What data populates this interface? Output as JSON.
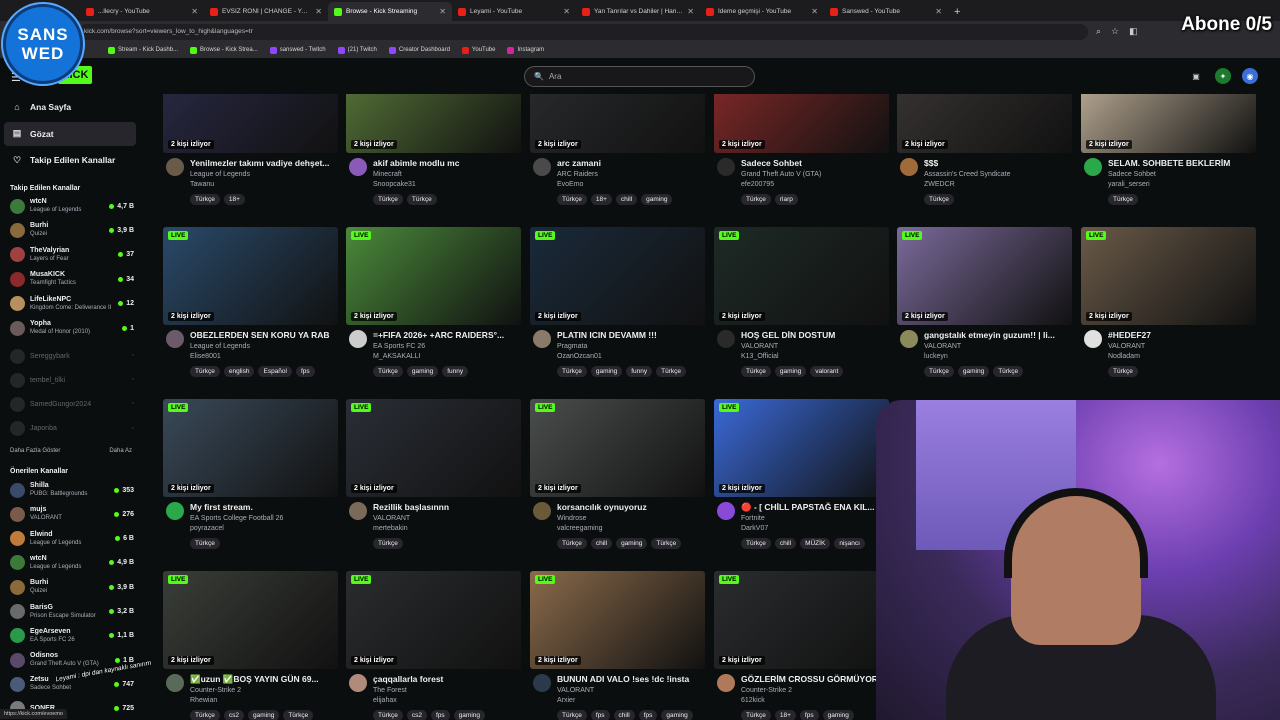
{
  "browser": {
    "tabs": [
      {
        "label": "...llecry - YouTube",
        "fav": "yt",
        "active": false
      },
      {
        "label": "EVSİZ RONİ | CHANGE - YouTub...",
        "fav": "yt",
        "active": false
      },
      {
        "label": "Browse - Kick Streaming",
        "fav": "kick",
        "active": true
      },
      {
        "label": "Leyami - YouTube",
        "fav": "yt",
        "active": false
      },
      {
        "label": "Yan Tanrılar vs Dahiler | Hangisi...",
        "fav": "yt",
        "active": false
      },
      {
        "label": "İdeme geçmişi - YouTube",
        "fav": "yt",
        "active": false
      },
      {
        "label": "Sanswed - YouTube",
        "fav": "yt",
        "active": false
      }
    ],
    "url": "kick.com/browse?sort=viewers_low_to_high&languages=tr",
    "bookmarks": [
      {
        "label": "Stream - Kick Dashb...",
        "fav": "kick"
      },
      {
        "label": "Browse - Kick Strea...",
        "fav": "kick"
      },
      {
        "label": "sanswed - Twitch",
        "fav": "tw"
      },
      {
        "label": "(21) Twitch",
        "fav": "tw"
      },
      {
        "label": "Creator Dashboard",
        "fav": "tw"
      },
      {
        "label": "YouTube",
        "fav": "yt"
      },
      {
        "label": "Instagram",
        "fav": "ig"
      }
    ]
  },
  "overlay": {
    "logo_line1": "SANS",
    "logo_line2": "WED",
    "abone": "Abone 0/5",
    "popup": "Leyami : dpi dan kaynaklı sanırım"
  },
  "header": {
    "logo": "KICK",
    "search_placeholder": "Ara",
    "search_icon": "🔍"
  },
  "nav": [
    {
      "label": "Ana Sayfa",
      "icon": "⌂",
      "active": false
    },
    {
      "label": "Gözat",
      "icon": "▤",
      "active": true
    },
    {
      "label": "Takip Edilen Kanallar",
      "icon": "♡",
      "active": false
    }
  ],
  "followed_title": "Takip Edilen Kanallar",
  "followed": [
    {
      "name": "wtcN",
      "game": "League of Legends",
      "viewers": "4,7 B",
      "color": "#3c7a3a"
    },
    {
      "name": "Burhi",
      "game": "Quizei",
      "viewers": "3,9 B",
      "color": "#8a6a3a"
    },
    {
      "name": "TheValyrian",
      "game": "Layers of Fear",
      "viewers": "37",
      "color": "#a04040"
    },
    {
      "name": "MusaKICK",
      "game": "Teamfight Tactics",
      "viewers": "34",
      "color": "#8a2a2a"
    },
    {
      "name": "LifeLikeNPC",
      "game": "Kingdom Come: Deliverance II",
      "viewers": "12",
      "color": "#b89060"
    },
    {
      "name": "Yopha",
      "game": "Medal of Honor (2010)",
      "viewers": "1",
      "color": "#6a5a5a"
    }
  ],
  "offline": [
    "Sereggybark",
    "tembel_tilki",
    "SamedGungor2024",
    "Japonba"
  ],
  "show_more": "Daha Fazla Göster",
  "show_less": "Daha Az",
  "recommended_title": "Önerilen Kanallar",
  "recommended": [
    {
      "name": "Shilla",
      "game": "PUBG: Battlegrounds",
      "viewers": "353",
      "color": "#3a4a6a"
    },
    {
      "name": "mujs",
      "game": "VALORANT",
      "viewers": "276",
      "color": "#7a5a4a"
    },
    {
      "name": "Elwind",
      "game": "League of Legends",
      "viewers": "6 B",
      "color": "#c07a3a"
    },
    {
      "name": "wtcN",
      "game": "League of Legends",
      "viewers": "4,9 B",
      "color": "#3c7a3a"
    },
    {
      "name": "Burhi",
      "game": "Quizei",
      "viewers": "3,9 B",
      "color": "#8a6a3a"
    },
    {
      "name": "BarisG",
      "game": "Prison Escape Simulator",
      "viewers": "3,2 B",
      "color": "#6a6a6a"
    },
    {
      "name": "EgeArseven",
      "game": "EA Sports FC 26",
      "viewers": "1,1 B",
      "color": "#2a9a4a"
    },
    {
      "name": "Odisnos",
      "game": "Grand Theft Auto V (GTA)",
      "viewers": "1 B",
      "color": "#5a4a6a"
    },
    {
      "name": "Zetsu",
      "game": "Sadece Sohbet",
      "viewers": "747",
      "color": "#4a5a7a"
    },
    {
      "name": "SONER",
      "game": "",
      "viewers": "725",
      "color": "#7a7a7a"
    }
  ],
  "streams": [
    {
      "title": "Yenilmezler takımı vadiye dehşet...",
      "category": "League of Legends",
      "channel": "Tawanu",
      "viewers": "2 kişi izliyor",
      "live": false,
      "tags": [
        "Türkçe",
        "18+"
      ],
      "thumb": "#2a2a48",
      "avatar": "#6a5a4a"
    },
    {
      "title": "akif abimle modlu mc",
      "category": "Minecraft",
      "channel": "Snoopcake31",
      "viewers": "2 kişi izliyor",
      "live": false,
      "tags": [
        "Türkçe",
        "Türkçe"
      ],
      "thumb": "#5a7a3a",
      "avatar": "#8a5ab8"
    },
    {
      "title": "arc zamani",
      "category": "ARC Raiders",
      "channel": "EvoEmo",
      "viewers": "2 kişi izliyor",
      "live": false,
      "tags": [
        "Türkçe",
        "18+",
        "chill",
        "gaming"
      ],
      "thumb": "#2a2c2e",
      "avatar": "#4a4a4a"
    },
    {
      "title": "Sadece Sohbet",
      "category": "Grand Theft Auto V (GTA)",
      "channel": "efe200795",
      "viewers": "2 kişi izliyor",
      "live": false,
      "tags": [
        "Türkçe",
        "rlarp"
      ],
      "thumb": "#8a2a2a",
      "avatar": "#2a2a2a"
    },
    {
      "title": "$$$",
      "category": "Assassin's Creed Syndicate",
      "channel": "ZWEDCR",
      "viewers": "2 kişi izliyor",
      "live": false,
      "tags": [
        "Türkçe"
      ],
      "thumb": "#3a3634",
      "avatar": "#a06a3a"
    },
    {
      "title": "SELAM. SOHBETE BEKLERİM",
      "category": "Sadece Sohbet",
      "channel": "yarali_serseri",
      "viewers": "2 kişi izliyor",
      "live": false,
      "tags": [
        "Türkçe"
      ],
      "thumb": "#c8b8a0",
      "avatar": "#2aa84a"
    },
    {
      "title": "OBEZLERDEN SEN KORU YA RAB",
      "category": "League of Legends",
      "channel": "Elise8001",
      "viewers": "2 kişi izliyor",
      "live": true,
      "tags": [
        "Türkçe",
        "english",
        "Español",
        "fps"
      ],
      "thumb": "#2a4a6a",
      "avatar": "#6a5a6a"
    },
    {
      "title": "=+FIFA 2026+ +ARC RAIDERS°...",
      "category": "EA Sports FC 26",
      "channel": "M_AKSAKALLI",
      "viewers": "2 kişi izliyor",
      "live": true,
      "tags": [
        "Türkçe",
        "gaming",
        "funny"
      ],
      "thumb": "#4a8a3a",
      "avatar": "#cccccc"
    },
    {
      "title": "PLATIN ICIN DEVAMM !!!",
      "category": "Pragmata",
      "channel": "OzanOzcan01",
      "viewers": "2 kişi izliyor",
      "live": true,
      "tags": [
        "Türkçe",
        "gaming",
        "funny",
        "Türkçe"
      ],
      "thumb": "#1a2a3a",
      "avatar": "#8a7a6a"
    },
    {
      "title": "HOŞ GEL DİN DOSTUM",
      "category": "VALORANT",
      "channel": "K13_Official",
      "viewers": "2 kişi izliyor",
      "live": true,
      "tags": [
        "Türkçe",
        "gaming",
        "valorant"
      ],
      "thumb": "#1e2a26",
      "avatar": "#2a2a2a"
    },
    {
      "title": "gangstalık etmeyin guzum!! | li...",
      "category": "VALORANT",
      "channel": "luckeyn",
      "viewers": "2 kişi izliyor",
      "live": true,
      "tags": [
        "Türkçe",
        "gaming",
        "Türkçe"
      ],
      "thumb": "#7a6a9a",
      "avatar": "#8a8a5a"
    },
    {
      "title": "#HEDEF27",
      "category": "VALORANT",
      "channel": "Nodladam",
      "viewers": "2 kişi izliyor",
      "live": true,
      "tags": [
        "Türkçe"
      ],
      "thumb": "#6a5a48",
      "avatar": "#e0e0e0"
    },
    {
      "title": "My first stream.",
      "category": "EA Sports College Football 26",
      "channel": "poyrazacel",
      "viewers": "2 kişi izliyor",
      "live": true,
      "tags": [
        "Türkçe"
      ],
      "thumb": "#3a4a5a",
      "avatar": "#2aa84a"
    },
    {
      "title": "Rezillik başlasınnn",
      "category": "VALORANT",
      "channel": "mertebakin",
      "viewers": "2 kişi izliyor",
      "live": true,
      "tags": [
        "Türkçe"
      ],
      "thumb": "#2a2e36",
      "avatar": "#7a6a5a"
    },
    {
      "title": "korsancılık oynuyoruz",
      "category": "Windrose",
      "channel": "valcreegaming",
      "viewers": "2 kişi izliyor",
      "live": true,
      "tags": [
        "Türkçe",
        "chill",
        "gaming",
        "Türkçe"
      ],
      "thumb": "#4a4e4c",
      "avatar": "#6a5a3a"
    },
    {
      "title": "🔴 - [ CHİLL PAPSTAĞ ENA KIL...",
      "category": "Fortnite",
      "channel": "DarkV07",
      "viewers": "2 kişi izliyor",
      "live": true,
      "tags": [
        "Türkçe",
        "chill",
        "MÜZİK",
        "nişancı"
      ],
      "thumb": "#3a6ad8",
      "avatar": "#8a4ad8"
    },
    {
      "title": "✅uzun ✅BOŞ YAYIN GÜN 69...",
      "category": "Counter-Strike 2",
      "channel": "Rhewian",
      "viewers": "2 kişi izliyor",
      "live": true,
      "tags": [
        "Türkçe",
        "cs2",
        "gaming",
        "Türkçe"
      ],
      "thumb": "#3a3e38",
      "avatar": "#5a6a5a"
    },
    {
      "title": "çaqqallarla forest",
      "category": "The Forest",
      "channel": "elijahax",
      "viewers": "2 kişi izliyor",
      "live": true,
      "tags": [
        "Türkçe",
        "cs2",
        "fps",
        "gaming"
      ],
      "thumb": "#2a2c2e",
      "avatar": "#b08a7a"
    },
    {
      "title": "BUNUN ADI VALO !ses !dc !insta",
      "category": "VALORANT",
      "channel": "Arxier",
      "viewers": "2 kişi izliyor",
      "live": true,
      "tags": [
        "Türkçe",
        "fps",
        "chill",
        "fps",
        "gaming"
      ],
      "thumb": "#8a6a4a",
      "avatar": "#2a3a4a"
    },
    {
      "title": "GÖZLERİM CROSSU GÖRMÜYOR",
      "category": "Counter-Strike 2",
      "channel": "612kick",
      "viewers": "2 kişi izliyor",
      "live": true,
      "tags": [
        "Türkçe",
        "18+",
        "fps",
        "gaming"
      ],
      "thumb": "#2a2c2e",
      "avatar": "#b07a5a"
    }
  ],
  "statusbar": "https://kick.com/evoemo"
}
